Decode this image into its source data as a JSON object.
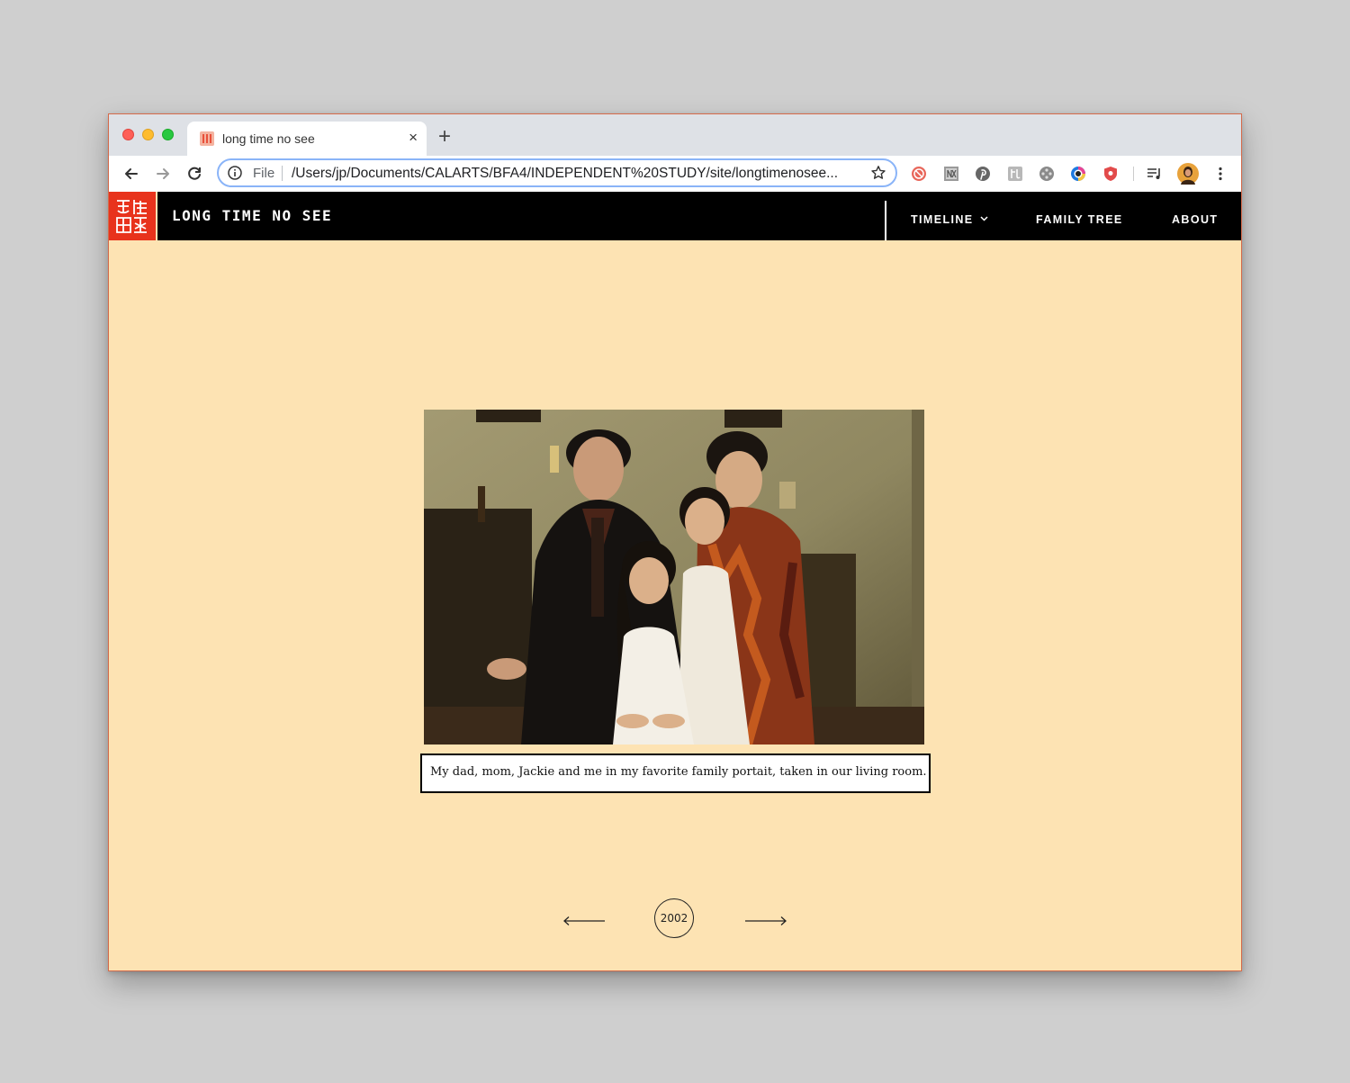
{
  "browser": {
    "tab": {
      "title": "long time no see",
      "close": "×"
    },
    "new_tab": "+",
    "address_bar": {
      "scheme_label": "File",
      "url": "/Users/jp/Documents/CALARTS/BFA4/INDEPENDENT%20STUDY/site/longtimenosee..."
    },
    "extensions": [
      "adblock-icon",
      "nx-icon",
      "pinterest-icon",
      "kanji-icon",
      "settings-wheel-icon",
      "color-ring-icon",
      "shield-icon",
      "reading-list-icon",
      "profile-avatar",
      "menu-kebab-icon"
    ]
  },
  "site": {
    "title": "LONG TIME NO SEE",
    "nav": {
      "timeline": "TIMELINE",
      "family_tree": "FAMILY TREE",
      "about": "ABOUT"
    }
  },
  "content": {
    "photo_alt": "Family portrait in living room",
    "caption": "My dad, mom, Jackie and me in my favorite family portait, taken in our living room.",
    "year": "2002"
  },
  "colors": {
    "page_bg": "#fde3b3",
    "header_bg": "#000000",
    "logo_bg": "#e8331c"
  }
}
